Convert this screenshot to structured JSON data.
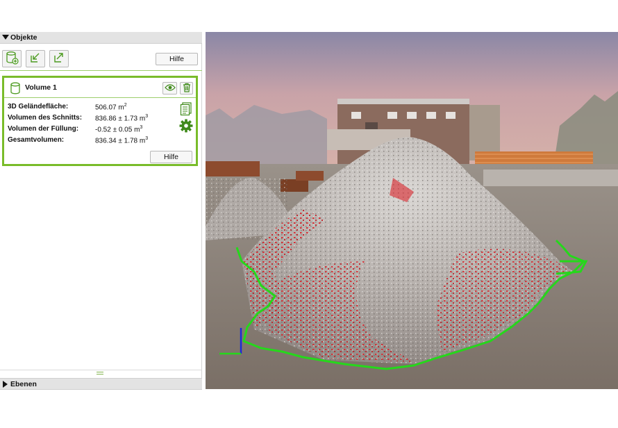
{
  "panels": {
    "objects_title": "Objekte",
    "layers_title": "Ebenen"
  },
  "toolbar": {
    "help_label": "Hilfe",
    "buttons": [
      "add-volume-icon",
      "import-icon",
      "export-icon"
    ]
  },
  "volume_card": {
    "title": "Volume 1",
    "help_label": "Hilfe",
    "rows": [
      {
        "label": "3D Geländefläche:",
        "value": "506.07  m",
        "unit_sup": "2"
      },
      {
        "label": "Volumen des Schnitts:",
        "value": "836.86  ± 1.73  m",
        "unit_sup": "3"
      },
      {
        "label": "Volumen der Füllung:",
        "value": "-0.52  ± 0.05  m",
        "unit_sup": "3"
      },
      {
        "label": "Gesamtvolumen:",
        "value": "836.34  ± 1.78  m",
        "unit_sup": "3"
      }
    ]
  },
  "colors": {
    "accent_green": "#79bc2a",
    "outline_green": "#25d81b",
    "cut_red": "#d8232a",
    "axis_blue": "#1c2bd6"
  }
}
